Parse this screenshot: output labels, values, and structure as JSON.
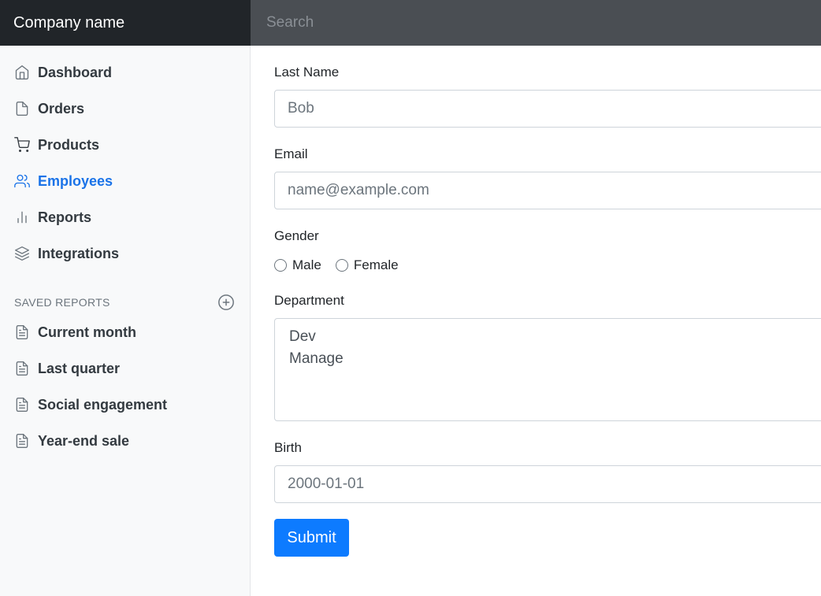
{
  "header": {
    "brand": "Company name",
    "search_placeholder": "Search"
  },
  "sidebar": {
    "items": [
      {
        "label": "Dashboard",
        "icon": "home-icon"
      },
      {
        "label": "Orders",
        "icon": "file-icon"
      },
      {
        "label": "Products",
        "icon": "cart-icon"
      },
      {
        "label": "Employees",
        "icon": "users-icon",
        "active": true
      },
      {
        "label": "Reports",
        "icon": "bar-chart-icon"
      },
      {
        "label": "Integrations",
        "icon": "layers-icon"
      }
    ],
    "saved_reports_title": "SAVED REPORTS",
    "saved_reports": [
      {
        "label": "Current month",
        "icon": "file-text-icon"
      },
      {
        "label": "Last quarter",
        "icon": "file-text-icon"
      },
      {
        "label": "Social engagement",
        "icon": "file-text-icon"
      },
      {
        "label": "Year-end sale",
        "icon": "file-text-icon"
      }
    ]
  },
  "form": {
    "last_name_label": "Last Name",
    "last_name_placeholder": "Bob",
    "email_label": "Email",
    "email_placeholder": "name@example.com",
    "gender_label": "Gender",
    "gender_options": [
      "Male",
      "Female"
    ],
    "department_label": "Department",
    "department_options": [
      "Dev",
      "Manage"
    ],
    "birth_label": "Birth",
    "birth_placeholder": "2000-01-01",
    "submit_label": "Submit"
  },
  "colors": {
    "active": "#1a73e8",
    "primary_button": "#0d7bff",
    "topbar": "#212529"
  }
}
